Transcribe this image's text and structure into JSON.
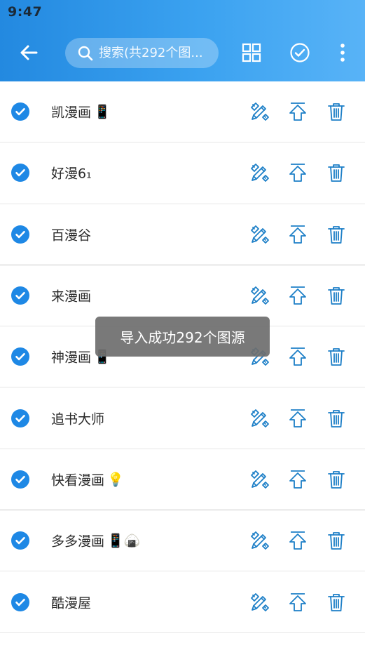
{
  "status": {
    "time": "9:47"
  },
  "header": {
    "search_placeholder": "搜索(共292个图...",
    "icons": [
      "back-arrow",
      "search",
      "grid",
      "check-circle",
      "more-vert"
    ]
  },
  "sources": [
    {
      "name": "凯漫画",
      "emoji": "📱"
    },
    {
      "name": "好漫6₁",
      "emoji": ""
    },
    {
      "name": "百漫谷",
      "emoji": ""
    },
    {
      "name": "来漫画",
      "emoji": ""
    },
    {
      "name": "神漫画",
      "emoji": "📱"
    },
    {
      "name": "追书大师",
      "emoji": ""
    },
    {
      "name": "快看漫画",
      "emoji": "💡"
    },
    {
      "name": "多多漫画",
      "emoji": "📱🍙"
    },
    {
      "name": "酷漫屋",
      "emoji": ""
    }
  ],
  "toast": "导入成功292个图源",
  "colors": {
    "accent": "#2389e0",
    "check": "#1e88e5",
    "action_icon": "#1d7fc7"
  }
}
